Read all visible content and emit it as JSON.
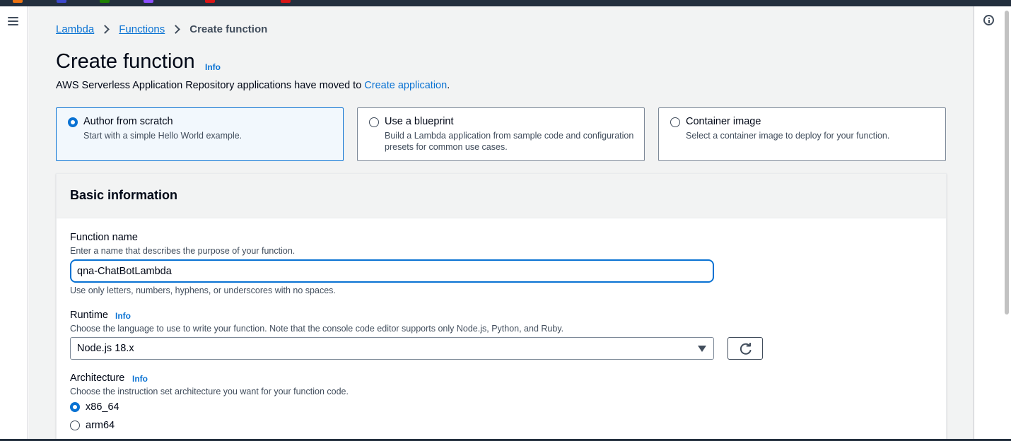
{
  "breadcrumb": {
    "items": [
      "Lambda",
      "Functions"
    ],
    "current": "Create function"
  },
  "page": {
    "title": "Create function",
    "title_info": "Info",
    "notice_prefix": "AWS Serverless Application Repository applications have moved to ",
    "notice_link": "Create application",
    "notice_suffix": "."
  },
  "options": [
    {
      "title": "Author from scratch",
      "description": "Start with a simple Hello World example.",
      "selected": true
    },
    {
      "title": "Use a blueprint",
      "description": "Build a Lambda application from sample code and configuration presets for common use cases.",
      "selected": false
    },
    {
      "title": "Container image",
      "description": "Select a container image to deploy for your function.",
      "selected": false
    }
  ],
  "basic_info": {
    "heading": "Basic information",
    "function_name": {
      "label": "Function name",
      "description": "Enter a name that describes the purpose of your function.",
      "value": "qna-ChatBotLambda",
      "constraint": "Use only letters, numbers, hyphens, or underscores with no spaces."
    },
    "runtime": {
      "label": "Runtime",
      "info": "Info",
      "description": "Choose the language to use to write your function. Note that the console code editor supports only Node.js, Python, and Ruby.",
      "value": "Node.js 18.x"
    },
    "architecture": {
      "label": "Architecture",
      "info": "Info",
      "description": "Choose the instruction set architecture you want for your function code.",
      "options": [
        {
          "label": "x86_64",
          "selected": true
        },
        {
          "label": "arm64",
          "selected": false
        }
      ]
    }
  },
  "colors": {
    "accent": "#0972d3",
    "topbar": "#232f3e",
    "background": "#f2f3f3"
  },
  "icons": {
    "menu": "hamburger-menu-icon",
    "help": "info-icon",
    "refresh": "refresh-icon",
    "dropdown": "caret-down-icon"
  }
}
